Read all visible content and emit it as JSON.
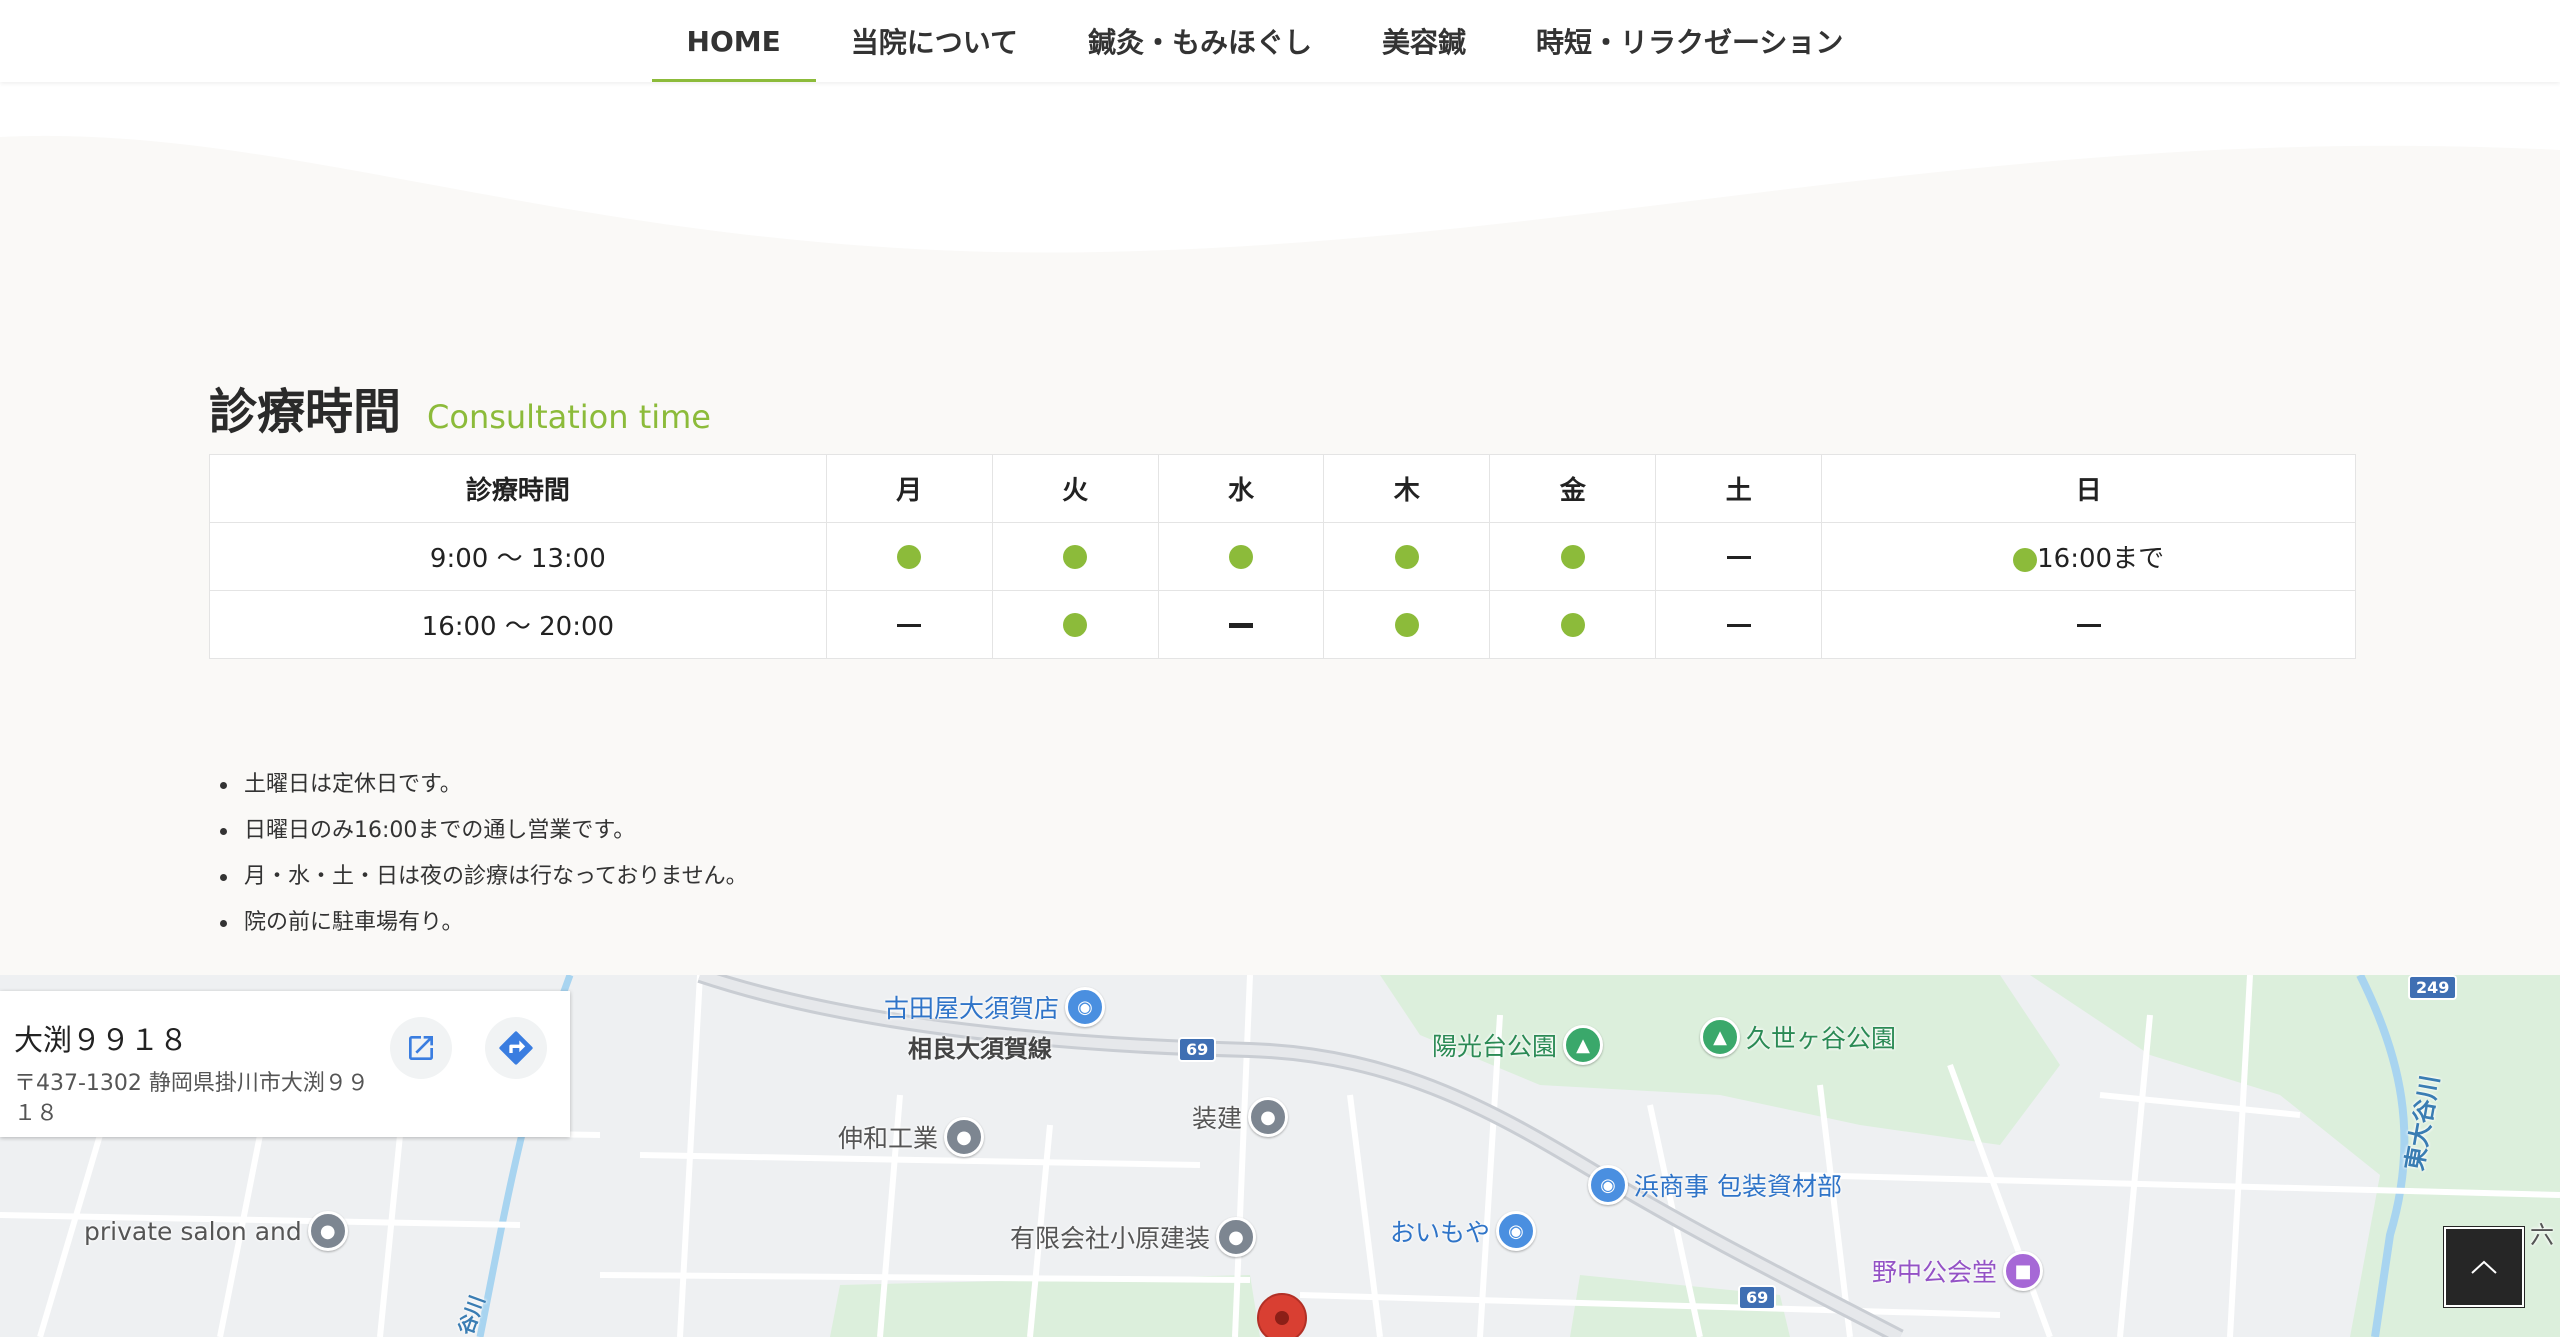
{
  "nav": {
    "items": [
      {
        "label": "HOME",
        "active": true
      },
      {
        "label": "当院について"
      },
      {
        "label": "鍼灸・もみほぐし"
      },
      {
        "label": "美容鍼"
      },
      {
        "label": "時短・リラクゼーション"
      }
    ],
    "accent_color": "#8cbb3a"
  },
  "section": {
    "title_ja": "診療時間",
    "title_en": "Consultation time"
  },
  "hours_table": {
    "headers": [
      "診療時間",
      "月",
      "火",
      "水",
      "木",
      "金",
      "土",
      "日"
    ],
    "rows": [
      {
        "time": "9:00 〜 13:00",
        "cells": [
          "open",
          "open",
          "open",
          "open",
          "open",
          "closed",
          "open"
        ],
        "sunday_note": "16:00まで"
      },
      {
        "time": "16:00 〜 20:00",
        "cells": [
          "closed",
          "open",
          "closed",
          "open",
          "open",
          "closed",
          "closed"
        ]
      }
    ],
    "dot_color": "#8cbb3a"
  },
  "notes": [
    "土曜日は定休日です。",
    "日曜日のみ16:00までの通し営業です。",
    "月・水・土・日は夜の診療は行なっておりません。",
    "院の前に駐車場有り。"
  ],
  "map": {
    "card": {
      "title": "大渕９９１８",
      "address": "〒437-1302 静岡県掛川市大渕９９１８",
      "open_icon": "open-in-new-icon",
      "directions_icon": "directions-icon"
    },
    "pois": {
      "furutaya": "古田屋大須賀店",
      "road": "相良大須賀線",
      "route69": "69",
      "youkoudai": "陽光台公園",
      "kuseyaya": "久世ヶ谷公園",
      "shinwa": "伸和工業",
      "souken": "装建",
      "hamashouji": "浜商事 包装資材部",
      "oimoya": "おいもや",
      "private_salon": "private salon and",
      "kohara": "有限会社小原建装",
      "nonaka": "野中公会堂",
      "route249": "249",
      "river": "東大谷川",
      "river2": "谷川",
      "roku": "六"
    }
  },
  "back_to_top_icon": "chevron-up-icon"
}
